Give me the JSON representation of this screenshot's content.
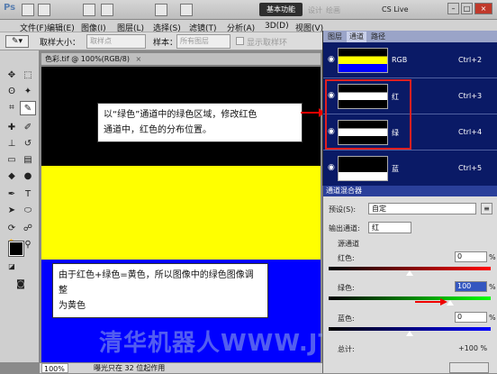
{
  "menubar": {
    "logo": "Ps",
    "items": [
      "文件(F)",
      "编辑(E)",
      "图像(I)",
      "图层(L)",
      "选择(S)",
      "滤镜(T)",
      "分析(A)",
      "3D(D)",
      "视图(V)"
    ],
    "workspace": "基本功能",
    "ghost1": "设计",
    "ghost2": "绘画",
    "cslive": "CS Live"
  },
  "options": {
    "sample_size_label": "取样大小：",
    "sample_size_value": "取样点",
    "sample_label": "样本：",
    "sample_value": "所有图层",
    "show_ring": "显示取样环"
  },
  "document": {
    "tab_title": "色彩.tif @ 100%(RGB/8)",
    "close": "×"
  },
  "callouts": {
    "top_line1": "以“绿色”通道中的绿色区域，修改红色",
    "top_line2": "通道中，红色的分布位置。",
    "bottom_line1": "由于红色+绿色=黄色，所以图像中的绿色图像调整",
    "bottom_line2": "为黄色"
  },
  "canvas_colors": {
    "black": "#000000",
    "yellow": "#ffff00",
    "blue": "#0000ff"
  },
  "watermark": "清华机器人WWW.JTLVI.NET",
  "status": {
    "zoom": "100%",
    "info": "曝光只在 32 位起作用"
  },
  "channels_panel": {
    "tabs": [
      "图层",
      "通道",
      "路径"
    ],
    "rows": [
      {
        "name": "RGB",
        "key": "Ctrl+2"
      },
      {
        "name": "红",
        "key": "Ctrl+3"
      },
      {
        "name": "绿",
        "key": "Ctrl+4"
      },
      {
        "name": "蓝",
        "key": "Ctrl+5"
      }
    ]
  },
  "mixer": {
    "title": "通道混合器",
    "preset_label": "预设(S):",
    "preset_value": "自定",
    "output_label": "输出通道:",
    "output_value": "红",
    "source_label": "源通道",
    "red_label": "红色:",
    "red_value": "0",
    "green_label": "绿色:",
    "green_value": "100",
    "blue_label": "蓝色:",
    "blue_value": "0",
    "pct": "%",
    "total_label": "总计:",
    "total_value": "+100 %",
    "red_level": 0,
    "green_level": 100,
    "blue_level": 0
  }
}
